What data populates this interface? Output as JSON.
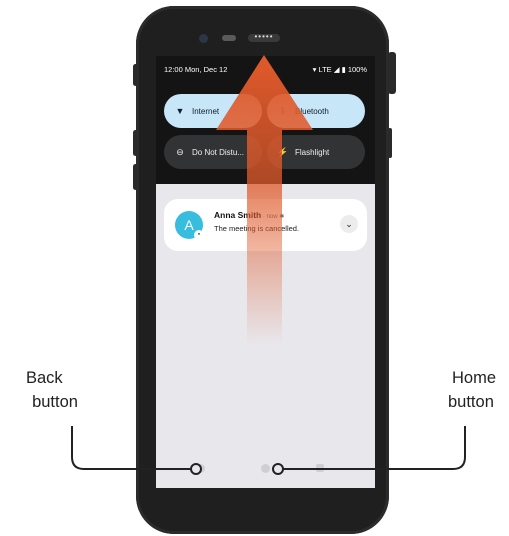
{
  "status_bar": {
    "time_date": "12:00 Mon, Dec 12",
    "right_info": "LTE ◢ ▮ 100%"
  },
  "quick_tiles": [
    {
      "label": "Internet",
      "icon": "wifi-icon",
      "state": "on"
    },
    {
      "label": "Bluetooth",
      "icon": "bluetooth-icon",
      "state": "on"
    },
    {
      "label": "Do Not Distu...",
      "icon": "do-not-disturb-icon",
      "state": "off"
    },
    {
      "label": "Flashlight",
      "icon": "flashlight-icon",
      "state": "off"
    }
  ],
  "notification": {
    "avatar_letter": "A",
    "sender": "Anna Smith",
    "meta": " · now ✱",
    "message": "The meeting is cancelled."
  },
  "callouts": {
    "back_line1": "Back",
    "back_line2": "button",
    "home_line1": "Home",
    "home_line2": "button"
  },
  "colors": {
    "arrow": "#e05a2b",
    "tile_on": "#c7e6f8",
    "avatar": "#39bdde"
  }
}
